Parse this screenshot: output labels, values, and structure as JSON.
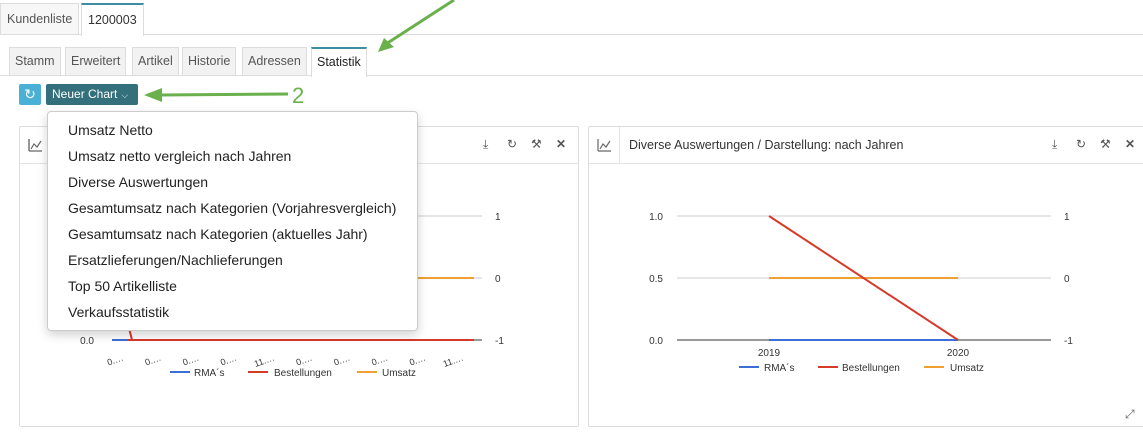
{
  "top_tabs": [
    {
      "label": "Kundenliste"
    },
    {
      "label": "1200003"
    }
  ],
  "sub_tabs": [
    {
      "label": "Stamm"
    },
    {
      "label": "Erweitert"
    },
    {
      "label": "Artikel"
    },
    {
      "label": "Historie"
    },
    {
      "label": "Adressen"
    },
    {
      "label": "Statistik"
    }
  ],
  "toolbar": {
    "refresh_icon": "refresh-icon",
    "new_chart_label": "Neuer Chart"
  },
  "annotation": {
    "number": "2",
    "color": "#6ab04c"
  },
  "dropdown": {
    "items": [
      "Umsatz Netto",
      "Umsatz netto vergleich nach Jahren",
      "Diverse Auswertungen",
      "Gesamtumsatz nach Kategorien (Vorjahresvergleich)",
      "Gesamtumsatz nach Kategorien (aktuelles Jahr)",
      "Ersatzlieferungen/Nachlieferungen",
      "Top 50 Artikelliste",
      "Verkaufsstatistik"
    ]
  },
  "panels": [
    {
      "title": ""
    },
    {
      "title": "Diverse Auswertungen / Darstellung: nach Jahren"
    }
  ],
  "colors": {
    "accent": "#33707c",
    "refresh": "#4ab0d6",
    "rma": "#3b6fd6",
    "bestellungen": "#d63b2a",
    "umsatz": "#f0a030"
  },
  "chart_data": [
    {
      "type": "line",
      "x": [
        "0.…",
        "0.…",
        "0.…",
        "0.…",
        "11.…",
        "0.…",
        "0.…",
        "0.…",
        "0.…",
        "11.…"
      ],
      "left_axis": {
        "ticks": [
          "0.0"
        ]
      },
      "right_axis": {
        "ticks": [
          "1",
          "0",
          "-1"
        ],
        "range": [
          -1,
          1
        ]
      },
      "series": [
        {
          "name": "RMA´s",
          "values": [
            0,
            0,
            0,
            0,
            0,
            0,
            0,
            0,
            0,
            0
          ]
        },
        {
          "name": "Bestellungen",
          "values": [
            0,
            0,
            0,
            0,
            0,
            0,
            0,
            0,
            0,
            0
          ]
        },
        {
          "name": "Umsatz",
          "values": [
            0,
            0,
            0,
            0,
            0,
            0,
            0,
            0,
            0,
            0
          ]
        }
      ],
      "legend": "bottom"
    },
    {
      "type": "line",
      "x": [
        "2019",
        "2020"
      ],
      "left_axis": {
        "ticks": [
          "1.0",
          "0.5",
          "0.0"
        ],
        "range": [
          0,
          1
        ]
      },
      "right_axis": {
        "ticks": [
          "1",
          "0",
          "-1"
        ],
        "range": [
          -1,
          1
        ]
      },
      "series": [
        {
          "name": "RMA´s",
          "axis": "left",
          "values": [
            0,
            0
          ]
        },
        {
          "name": "Bestellungen",
          "axis": "left",
          "values": [
            1,
            0
          ]
        },
        {
          "name": "Umsatz",
          "axis": "right",
          "values": [
            0,
            0
          ]
        }
      ],
      "legend": "bottom"
    }
  ]
}
